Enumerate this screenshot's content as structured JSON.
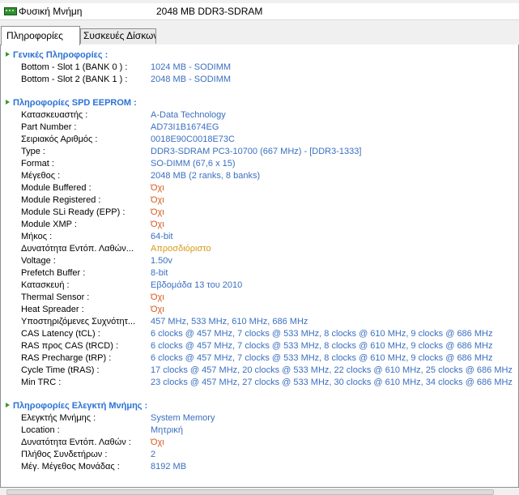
{
  "header": {
    "label": "Φυσική Μνήμη",
    "value": "2048  MB DDR3-SDRAM"
  },
  "tabs": [
    "Πληροφορίες",
    "Συσκευές Δίσκων"
  ],
  "sections": [
    {
      "title": "Γενικές Πληροφορίες :",
      "rows": [
        {
          "label": "Bottom - Slot 1 (BANK 0 ) :",
          "value": "1024  MB - SODIMM",
          "tone": "normal"
        },
        {
          "label": "Bottom - Slot 2 (BANK 1 ) :",
          "value": "2048  MB - SODIMM",
          "tone": "normal"
        }
      ]
    },
    {
      "title": "Πληροφορίες SPD EEPROM :",
      "rows": [
        {
          "label": "Κατασκευαστής :",
          "value": "A-Data Technology",
          "tone": "normal"
        },
        {
          "label": "Part Number :",
          "value": "AD73I1B1674EG",
          "tone": "normal"
        },
        {
          "label": "Σειριακός Αριθμός :",
          "value": "0018E90C0018E73C",
          "tone": "normal"
        },
        {
          "label": "Type :",
          "value": "DDR3-SDRAM PC3-10700 (667 MHz)  -  [DDR3-1333]",
          "tone": "normal"
        },
        {
          "label": "Format :",
          "value": "SO-DIMM (67,6 x 15)",
          "tone": "normal"
        },
        {
          "label": "Μέγεθος :",
          "value": "2048  MB (2 ranks, 8 banks)",
          "tone": "normal"
        },
        {
          "label": "Module Buffered :",
          "value": "Όχι",
          "tone": "no"
        },
        {
          "label": "Module Registered :",
          "value": "Όχι",
          "tone": "no"
        },
        {
          "label": "Module SLi Ready (EPP) :",
          "value": "Όχι",
          "tone": "no"
        },
        {
          "label": "Module XMP :",
          "value": "Όχι",
          "tone": "no"
        },
        {
          "label": "Μήκος :",
          "value": "64-bit",
          "tone": "normal"
        },
        {
          "label": "Δυνατότητα Εντόπ. Λαθών...",
          "value": "Απροσδιόριστο",
          "tone": "warn"
        },
        {
          "label": "Voltage :",
          "value": "1.50v",
          "tone": "normal"
        },
        {
          "label": "Prefetch Buffer :",
          "value": "8-bit",
          "tone": "normal"
        },
        {
          "label": "Κατασκευή :",
          "value": "Εβδομάδα 13 του 2010",
          "tone": "normal"
        },
        {
          "label": "Thermal Sensor :",
          "value": "Όχι",
          "tone": "no"
        },
        {
          "label": "Heat Spreader :",
          "value": "Όχι",
          "tone": "no"
        },
        {
          "label": "Υποστηριζόμενες Συχνότητ...",
          "value": "457 MHz, 533 MHz, 610 MHz, 686 MHz",
          "tone": "normal"
        },
        {
          "label": "CAS Latency (tCL) :",
          "value": "6 clocks @ 457 MHz, 7 clocks @ 533 MHz, 8 clocks @ 610 MHz, 9 clocks @ 686 MHz",
          "tone": "normal"
        },
        {
          "label": "RAS προς CAS (tRCD) :",
          "value": "6 clocks @ 457 MHz, 7 clocks @ 533 MHz, 8 clocks @ 610 MHz, 9 clocks @ 686 MHz",
          "tone": "normal"
        },
        {
          "label": "RAS Precharge (tRP) :",
          "value": "6 clocks @ 457 MHz, 7 clocks @ 533 MHz, 8 clocks @ 610 MHz, 9 clocks @ 686 MHz",
          "tone": "normal"
        },
        {
          "label": "Cycle Time (tRAS) :",
          "value": "17 clocks @ 457 MHz, 20 clocks @ 533 MHz, 22 clocks @ 610 MHz, 25 clocks @ 686 MHz",
          "tone": "normal"
        },
        {
          "label": "Min TRC :",
          "value": "23 clocks @ 457 MHz, 27 clocks @ 533 MHz, 30 clocks @ 610 MHz, 34 clocks @ 686 MHz",
          "tone": "normal"
        }
      ]
    },
    {
      "title": "Πληροφορίες Ελεγκτή Μνήμης :",
      "rows": [
        {
          "label": "Ελεγκτής Μνήμης :",
          "value": "System Memory",
          "tone": "normal"
        },
        {
          "label": "Location :",
          "value": "Μητρική",
          "tone": "normal"
        },
        {
          "label": "Δυνατότητα Εντόπ. Λαθών :",
          "value": "Όχι",
          "tone": "no"
        },
        {
          "label": "Πλήθος Συνδετήρων :",
          "value": "2",
          "tone": "normal"
        },
        {
          "label": "Μέγ. Μέγεθος Μονάδας :",
          "value": "8192 MB",
          "tone": "normal"
        }
      ]
    }
  ]
}
